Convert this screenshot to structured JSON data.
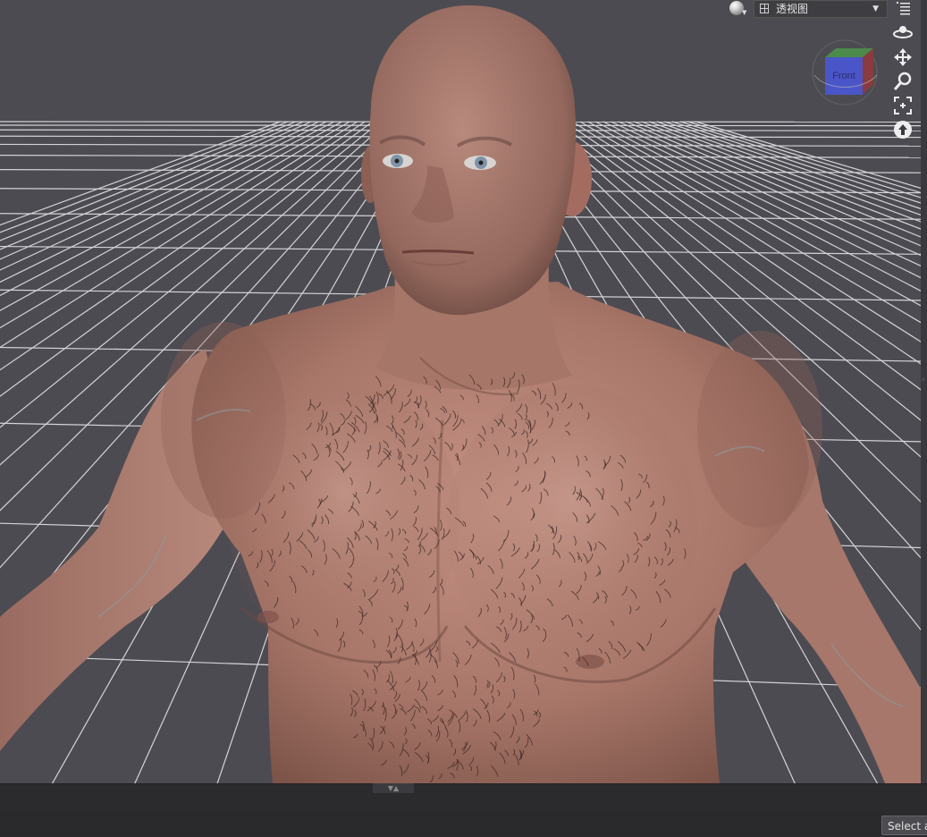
{
  "toolbar": {
    "view_label": "透视图",
    "dropdown_arrow": "▼",
    "render_mode_icon": "sphere-shading-icon",
    "menu_icon": "menu-list-icon"
  },
  "nav_cube": {
    "face_label": "Front",
    "face_color": "#4a55c8"
  },
  "nav_tools": [
    {
      "name": "orbit-icon"
    },
    {
      "name": "pan-icon"
    },
    {
      "name": "zoom-icon"
    },
    {
      "name": "frame-icon"
    },
    {
      "name": "reset-view-icon"
    }
  ],
  "status_bar": {
    "select_button_label": "Select a"
  },
  "colors": {
    "viewport_bg": "#4d4b52",
    "grid_line": "#d4d4d6",
    "skin": "#b98173",
    "panel_bg": "#2b2b2e"
  }
}
